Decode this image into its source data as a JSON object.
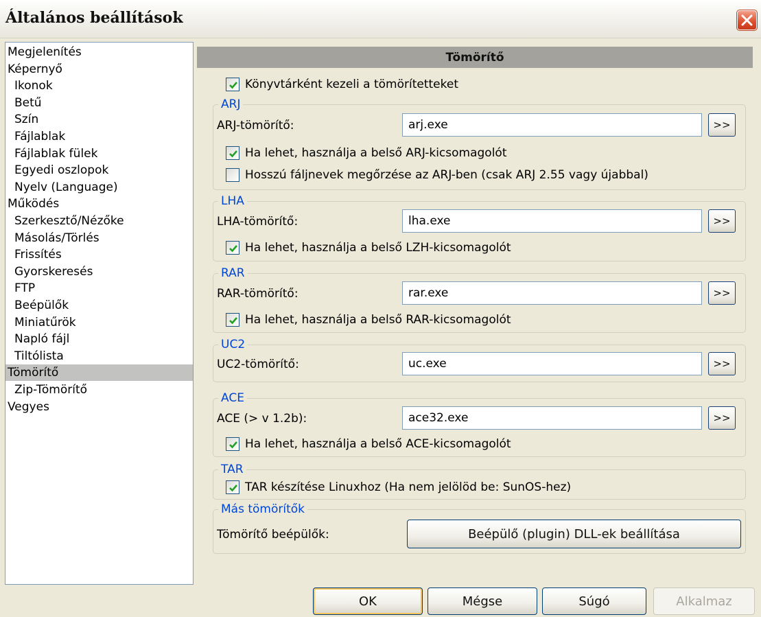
{
  "window": {
    "title": "Általános beállítások",
    "close_icon": "close-icon"
  },
  "tree": [
    {
      "label": "Megjelenítés",
      "level": 0
    },
    {
      "label": "Képernyő",
      "level": 0
    },
    {
      "label": "Ikonok",
      "level": 1
    },
    {
      "label": "Betű",
      "level": 1
    },
    {
      "label": "Szín",
      "level": 1
    },
    {
      "label": "Fájlablak",
      "level": 1
    },
    {
      "label": "Fájlablak fülek",
      "level": 1
    },
    {
      "label": "Egyedi oszlopok",
      "level": 1
    },
    {
      "label": "Nyelv (Language)",
      "level": 1
    },
    {
      "label": "Működés",
      "level": 0
    },
    {
      "label": "Szerkesztő/Nézőke",
      "level": 1
    },
    {
      "label": "Másolás/Törlés",
      "level": 1
    },
    {
      "label": "Frissítés",
      "level": 1
    },
    {
      "label": "Gyorskeresés",
      "level": 1
    },
    {
      "label": "FTP",
      "level": 1
    },
    {
      "label": "Beépülők",
      "level": 1
    },
    {
      "label": "Miniatűrök",
      "level": 1
    },
    {
      "label": "Napló fájl",
      "level": 1
    },
    {
      "label": "Tiltólista",
      "level": 1
    },
    {
      "label": "Tömörítő",
      "level": 0,
      "selected": true
    },
    {
      "label": "Zip-Tömörítő",
      "level": 1
    },
    {
      "label": "Vegyes",
      "level": 0
    }
  ],
  "panel": {
    "header": "Tömörítő",
    "treat_as_dirs": {
      "label": "Könyvtárként kezeli a tömörítetteket",
      "checked": true
    },
    "arj": {
      "title": "ARJ",
      "packer_label": "ARJ-tömörítő:",
      "packer_value": "arj.exe",
      "browse": ">>",
      "internal": {
        "label": "Ha lehet, használja a belső ARJ-kicsomagolót",
        "checked": true
      },
      "longnames": {
        "label": "Hosszú fáljnevek megőrzése az ARJ-ben (csak ARJ 2.55 vagy újabbal)",
        "checked": false
      }
    },
    "lha": {
      "title": "LHA",
      "packer_label": "LHA-tömörítő:",
      "packer_value": "lha.exe",
      "browse": ">>",
      "internal": {
        "label": "Ha lehet, használja a belső LZH-kicsomagolót",
        "checked": true
      }
    },
    "rar": {
      "title": "RAR",
      "packer_label": "RAR-tömörítő:",
      "packer_value": "rar.exe",
      "browse": ">>",
      "internal": {
        "label": "Ha lehet, használja a belső RAR-kicsomagolót",
        "checked": true
      }
    },
    "uc2": {
      "title": "UC2",
      "packer_label": "UC2-tömörítő:",
      "packer_value": "uc.exe",
      "browse": ">>"
    },
    "ace": {
      "title": "ACE",
      "packer_label": "ACE (> v 1.2b):",
      "packer_value": "ace32.exe",
      "browse": ">>",
      "internal": {
        "label": "Ha lehet, használja a belső ACE-kicsomagolót",
        "checked": true
      }
    },
    "tar": {
      "title": "TAR",
      "linux": {
        "label": "TAR készítése Linuxhoz (Ha nem jelölöd be: SunOS-hez)",
        "checked": true
      }
    },
    "other": {
      "title": "Más tömörítők",
      "plugins_label": "Tömörítő beépülők:",
      "plugins_button": "Beépülő (plugin) DLL-ek beállítása"
    }
  },
  "buttons": {
    "ok": "OK",
    "cancel": "Mégse",
    "help": "Súgó",
    "apply": "Alkalmaz"
  }
}
